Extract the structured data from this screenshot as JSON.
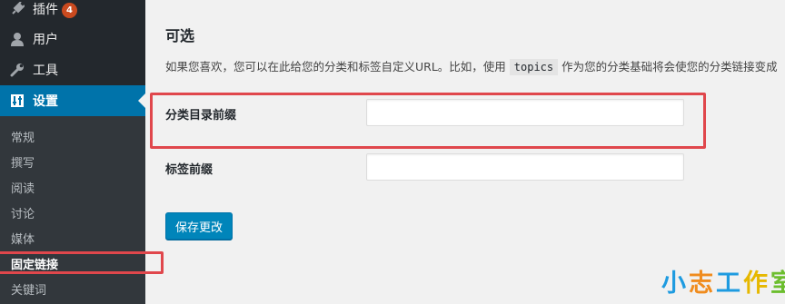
{
  "sidebar": {
    "menu": [
      {
        "label": "插件",
        "icon": "plugin-icon",
        "badge": "4"
      },
      {
        "label": "用户",
        "icon": "user-icon"
      },
      {
        "label": "工具",
        "icon": "wrench-icon"
      },
      {
        "label": "设置",
        "icon": "settings-icon"
      }
    ],
    "submenu": [
      "常规",
      "撰写",
      "阅读",
      "讨论",
      "媒体",
      "固定链接",
      "关键词"
    ]
  },
  "main": {
    "section_title": "可选",
    "desc_before": "如果您喜欢，您可以在此给您的分类和标签自定义URL。比如，使用 ",
    "desc_code": "topics",
    "desc_after": " 作为您的分类基础将会使您的分类链接变成",
    "category_label": "分类目录前缀",
    "category_value": "",
    "tag_label": "标签前缀",
    "tag_value": "",
    "save_label": "保存更改"
  },
  "watermark": {
    "c1": "小",
    "c2": "志",
    "c3": "工",
    "c4": "作",
    "c5": "室"
  },
  "colors": {
    "sidebar": "#23282d",
    "submenu": "#32373c",
    "active": "#0073aa",
    "button": "#0085ba",
    "highlight": "#e0474c"
  }
}
